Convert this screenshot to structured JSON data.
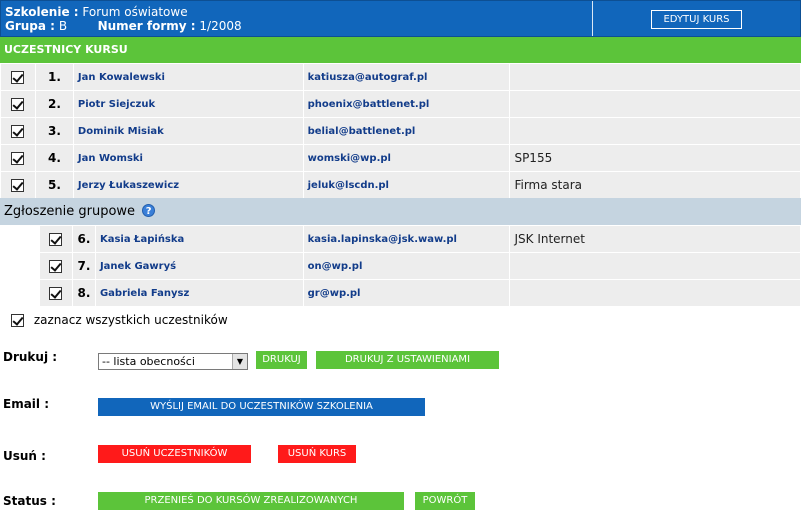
{
  "header": {
    "course_label": "Szkolenie :",
    "course_value": "Forum oświatowe",
    "group_label": "Grupa :",
    "group_value": "B",
    "form_label": "Numer formy :",
    "form_value": "1/2008",
    "edit_button": "EDYTUJ KURS"
  },
  "section_title": "UCZESTNICY KURSU",
  "participants": [
    {
      "num": "1.",
      "name": "Jan Kowalewski",
      "email": "katiusza@autograf.pl",
      "extra": ""
    },
    {
      "num": "2.",
      "name": "Piotr Siejczuk",
      "email": "phoenix@battlenet.pl",
      "extra": ""
    },
    {
      "num": "3.",
      "name": "Dominik Misiak",
      "email": "belial@battlenet.pl",
      "extra": ""
    },
    {
      "num": "4.",
      "name": "Jan Womski",
      "email": "womski@wp.pl",
      "extra": "SP155"
    },
    {
      "num": "5.",
      "name": "Jerzy Łukaszewicz",
      "email": "jeluk@lscdn.pl",
      "extra": "Firma stara"
    }
  ],
  "group_section_title": "Zgłoszenie grupowe",
  "group_participants": [
    {
      "num": "6.",
      "name": "Kasia Łapińska",
      "email": "kasia.lapinska@jsk.waw.pl",
      "extra": "JSK Internet"
    },
    {
      "num": "7.",
      "name": "Janek Gawryś",
      "email": "on@wp.pl",
      "extra": ""
    },
    {
      "num": "8.",
      "name": "Gabriela Fanysz",
      "email": "gr@wp.pl",
      "extra": ""
    }
  ],
  "select_all_label": "zaznacz wszystkich uczestników",
  "print": {
    "label": "Drukuj :",
    "select_value": "-- lista obecności",
    "print_button": "DRUKUJ",
    "print_settings_button": "DRUKUJ Z USTAWIENIAMI"
  },
  "email": {
    "label": "Email :",
    "send_button": "WYŚLIJ EMAIL DO UCZESTNIKÓW SZKOLENIA"
  },
  "delete": {
    "label": "Usuń :",
    "delete_participants_button": "USUŃ UCZESTNIKÓW",
    "delete_course_button": "USUŃ KURS"
  },
  "status": {
    "label": "Status :",
    "move_button": "PRZENIEŚ DO KURSÓW ZREALIZOWANYCH",
    "back_button": "POWRÓT"
  },
  "colors": {
    "header_blue": "#1166bb",
    "green": "#5cc43a",
    "red": "#ff1a1a",
    "group_bar": "#c5d4e0",
    "row_bg": "#ededed"
  },
  "icons": [
    "checkbox-checked-icon",
    "help-icon",
    "dropdown-arrow-icon"
  ]
}
